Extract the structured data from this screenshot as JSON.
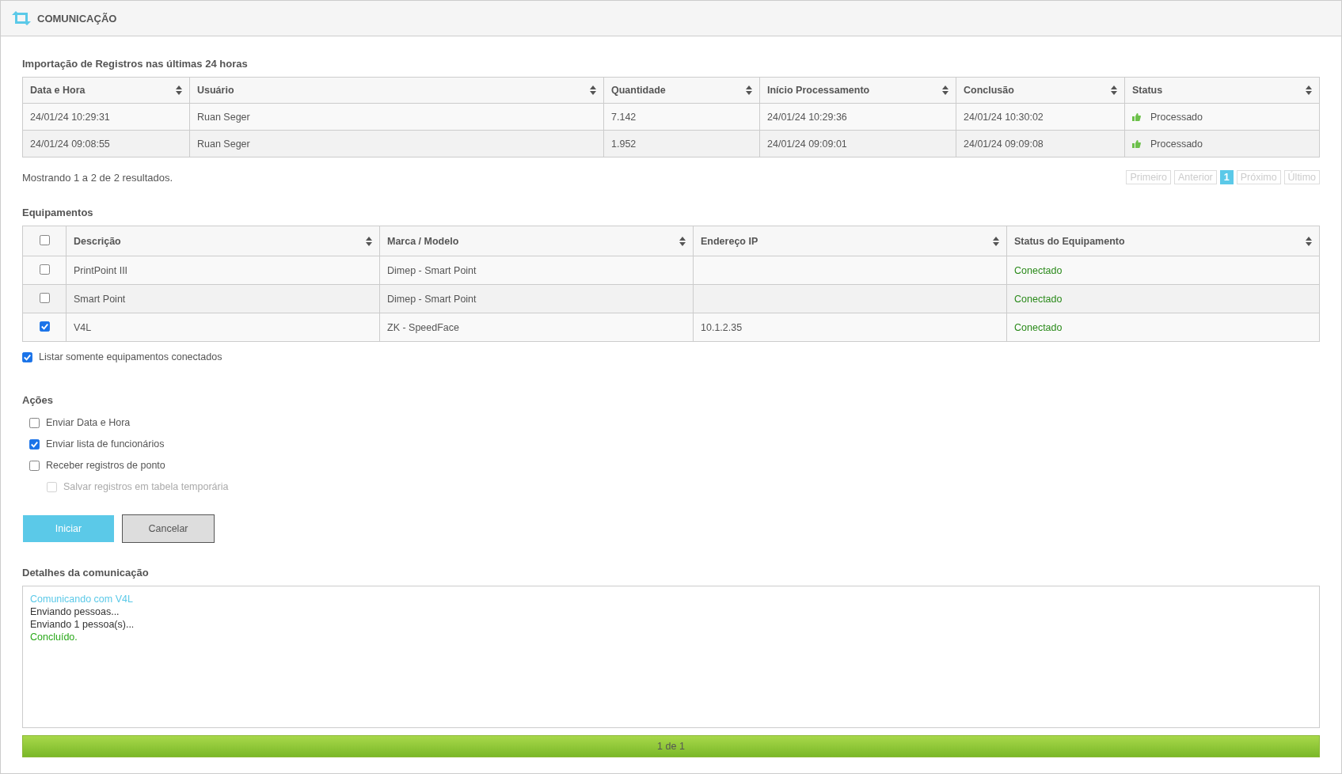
{
  "header": {
    "title": "COMUNICAÇÃO"
  },
  "imports": {
    "title": "Importação de Registros nas últimas 24 horas",
    "columns": [
      "Data e Hora",
      "Usuário",
      "Quantidade",
      "Início Processamento",
      "Conclusão",
      "Status"
    ],
    "rows": [
      {
        "cells": [
          "24/01/24 10:29:31",
          "Ruan Seger",
          "7.142",
          "24/01/24 10:29:36",
          "24/01/24 10:30:02"
        ],
        "status": "Processado"
      },
      {
        "cells": [
          "24/01/24 09:08:55",
          "Ruan Seger",
          "1.952",
          "24/01/24 09:09:01",
          "24/01/24 09:09:08"
        ],
        "status": "Processado"
      }
    ],
    "summary": "Mostrando 1 a 2 de 2 resultados.",
    "pagination": [
      {
        "label": "Primeiro",
        "selected": false,
        "disabled": true
      },
      {
        "label": "Anterior",
        "selected": false,
        "disabled": true
      },
      {
        "label": "1",
        "selected": true,
        "disabled": false
      },
      {
        "label": "Próximo",
        "selected": false,
        "disabled": true
      },
      {
        "label": "Último",
        "selected": false,
        "disabled": true
      }
    ]
  },
  "equipment": {
    "title": "Equipamentos",
    "all_checked": false,
    "columns": [
      "Descrição",
      "Marca / Modelo",
      "Endereço IP",
      "Status do Equipamento"
    ],
    "rows": [
      {
        "checked": false,
        "description": "PrintPoint III",
        "model": "Dimep - Smart Point",
        "ip": "",
        "status": "Conectado"
      },
      {
        "checked": false,
        "description": "Smart Point",
        "model": "Dimep - Smart Point",
        "ip": "",
        "status": "Conectado"
      },
      {
        "checked": true,
        "description": "V4L",
        "model": "ZK - SpeedFace",
        "ip": "10.1.2.35",
        "status": "Conectado"
      }
    ],
    "filter": {
      "label": "Listar somente equipamentos conectados",
      "checked": true
    }
  },
  "actions": {
    "title": "Ações",
    "options": [
      {
        "label": "Enviar Data e Hora",
        "checked": false,
        "disabled": false
      },
      {
        "label": "Enviar lista de funcionários",
        "checked": true,
        "disabled": false
      },
      {
        "label": "Receber registros de ponto",
        "checked": false,
        "disabled": false,
        "children": [
          {
            "label": "Salvar registros em tabela temporária",
            "checked": false,
            "disabled": true
          }
        ]
      }
    ],
    "buttons": [
      {
        "label": "Iniciar",
        "kind": "primary"
      },
      {
        "label": "Cancelar",
        "kind": "secondary"
      }
    ]
  },
  "log": {
    "title": "Detalhes da comunicação",
    "lines": [
      {
        "text": "Comunicando com V4L",
        "kind": "info"
      },
      {
        "text": "Enviando pessoas...",
        "kind": "normal"
      },
      {
        "text": "Enviando 1 pessoa(s)...",
        "kind": "normal"
      },
      {
        "text": "Concluído.",
        "kind": "success"
      }
    ]
  },
  "progress": {
    "level": 1,
    "text": "1 de 1"
  }
}
